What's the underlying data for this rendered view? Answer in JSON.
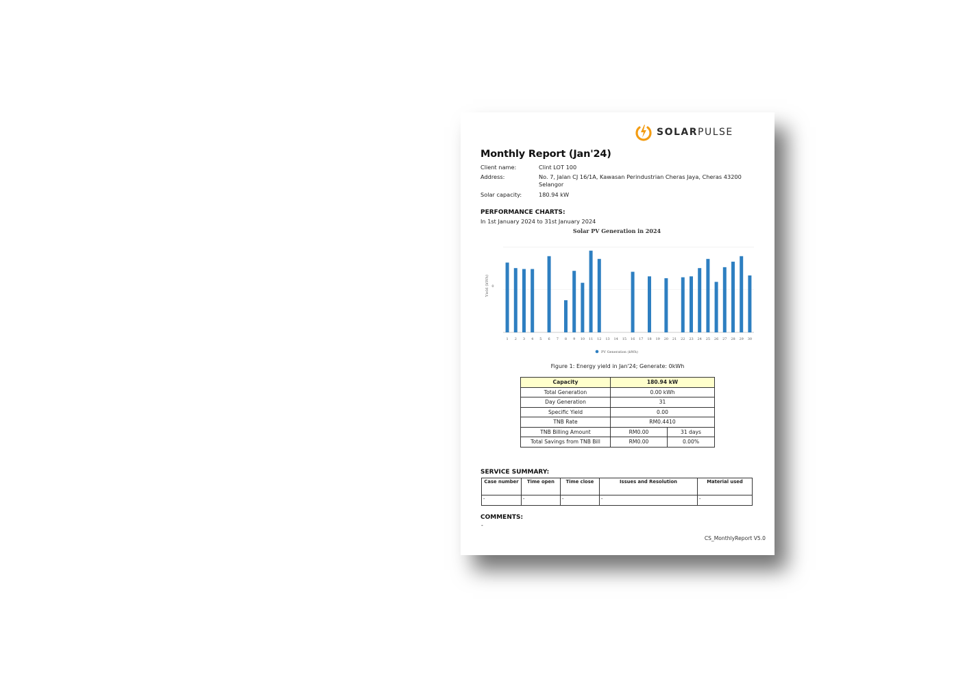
{
  "brand": {
    "name_bold": "SOLAR",
    "name_light": "PULSE",
    "accent": "#f39c12"
  },
  "report": {
    "title": "Monthly Report (Jan'24)",
    "client_label": "Client name:",
    "client_value": "Clint LOT 100",
    "address_label": "Address:",
    "address_value": "No. 7, Jalan CJ 16/1A, Kawasan Perindustrian Cheras Jaya, Cheras 43200 Selangor",
    "capacity_label": "Solar capacity:",
    "capacity_value": "180.94 kW"
  },
  "performance": {
    "heading": "PERFORMANCE CHARTS:",
    "period": "In 1st January 2024 to 31st January 2024",
    "caption": "Figure 1: Energy yield in Jan'24; Generate: 0kWh"
  },
  "chart_data": {
    "type": "bar",
    "title": "Solar PV Generation in 2024",
    "ylabel": "Yield (kWh)",
    "xlabel": "",
    "y_tick_labels": [
      "0"
    ],
    "legend": [
      "PV Generation (kWh)"
    ],
    "legend_position": "bottom",
    "grid": true,
    "color": "#2e7fc1",
    "ylim": [
      0,
      1
    ],
    "categories": [
      "1",
      "2",
      "3",
      "4",
      "5",
      "6",
      "7",
      "8",
      "9",
      "10",
      "11",
      "12",
      "13",
      "14",
      "15",
      "16",
      "17",
      "18",
      "19",
      "20",
      "21",
      "22",
      "23",
      "24",
      "25",
      "26",
      "27",
      "28",
      "29",
      "30"
    ],
    "values": [
      0.76,
      0.7,
      0.69,
      0.69,
      0,
      0.83,
      0,
      0.35,
      0.67,
      0.54,
      0.89,
      0.8,
      0,
      0,
      0,
      0.66,
      0,
      0.61,
      0,
      0.59,
      0,
      0.6,
      0.61,
      0.7,
      0.8,
      0.55,
      0.71,
      0.77,
      0.83,
      0.62
    ]
  },
  "stats": {
    "capacity_label": "Capacity",
    "capacity_value": "180.94 kW",
    "rows": [
      {
        "label": "Total Generation",
        "value": "0.00 kWh"
      },
      {
        "label": "Day Generation",
        "value": "31"
      },
      {
        "label": "Specific Yield",
        "value": "0.00"
      },
      {
        "label": "TNB Rate",
        "value": "RM0.4410"
      }
    ],
    "billing_label": "TNB Billing Amount",
    "billing_value": "RM0.00",
    "billing_days": "31 days",
    "savings_label": "Total Savings from TNB Bill",
    "savings_value": "RM0.00",
    "savings_pct": "0.00%"
  },
  "service": {
    "heading": "SERVICE SUMMARY:",
    "columns": [
      "Case number",
      "Time open",
      "Time close",
      "Issues and Resolution",
      "Material used"
    ],
    "row": [
      "-",
      "-",
      "-",
      "-",
      "-"
    ]
  },
  "comments": {
    "heading": "COMMENTS:",
    "value": "-"
  },
  "footer": "CS_MonthlyReport V5.0"
}
